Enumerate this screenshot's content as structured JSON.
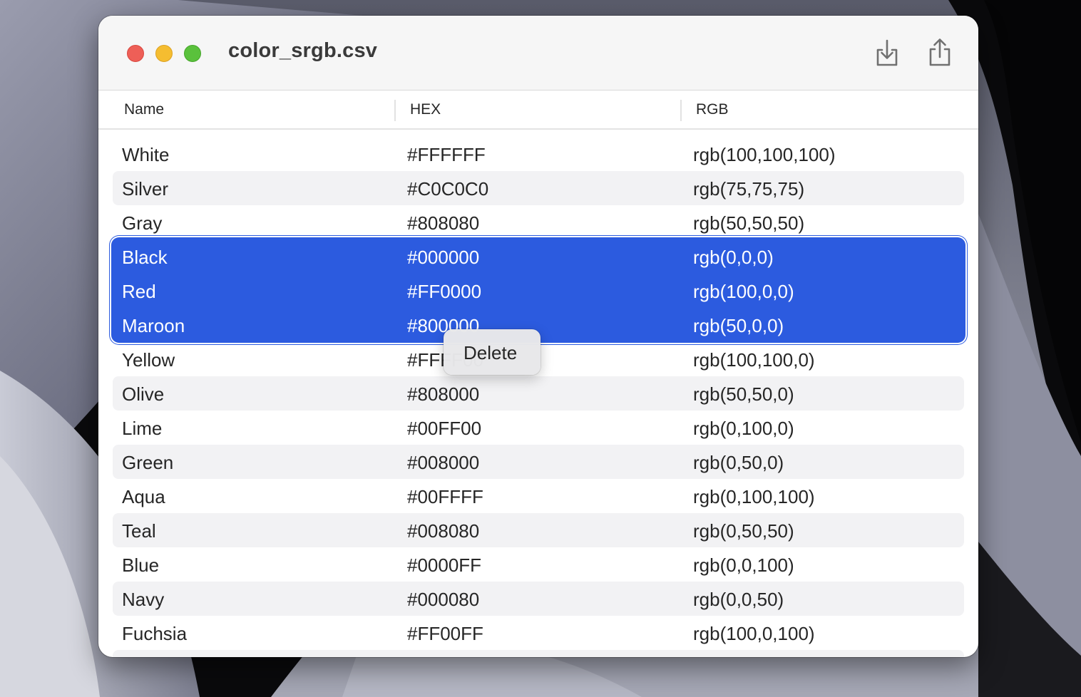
{
  "window": {
    "title": "color_srgb.csv"
  },
  "toolbar": {
    "download_icon": "download-tray-icon",
    "share_icon": "share-icon"
  },
  "table": {
    "columns": [
      "Name",
      "HEX",
      "RGB"
    ],
    "rows": [
      {
        "name": "White",
        "hex": "#FFFFFF",
        "rgb": "rgb(100,100,100)"
      },
      {
        "name": "Silver",
        "hex": "#C0C0C0",
        "rgb": "rgb(75,75,75)"
      },
      {
        "name": "Gray",
        "hex": "#808080",
        "rgb": "rgb(50,50,50)"
      },
      {
        "name": "Black",
        "hex": "#000000",
        "rgb": "rgb(0,0,0)"
      },
      {
        "name": "Red",
        "hex": "#FF0000",
        "rgb": "rgb(100,0,0)"
      },
      {
        "name": "Maroon",
        "hex": "#800000",
        "rgb": "rgb(50,0,0)"
      },
      {
        "name": "Yellow",
        "hex": "#FFFF00",
        "rgb": "rgb(100,100,0)"
      },
      {
        "name": "Olive",
        "hex": "#808000",
        "rgb": "rgb(50,50,0)"
      },
      {
        "name": "Lime",
        "hex": "#00FF00",
        "rgb": "rgb(0,100,0)"
      },
      {
        "name": "Green",
        "hex": "#008000",
        "rgb": "rgb(0,50,0)"
      },
      {
        "name": "Aqua",
        "hex": "#00FFFF",
        "rgb": "rgb(0,100,100)"
      },
      {
        "name": "Teal",
        "hex": "#008080",
        "rgb": "rgb(0,50,50)"
      },
      {
        "name": "Blue",
        "hex": "#0000FF",
        "rgb": "rgb(0,0,100)"
      },
      {
        "name": "Navy",
        "hex": "#000080",
        "rgb": "rgb(0,0,50)"
      },
      {
        "name": "Fuchsia",
        "hex": "#FF00FF",
        "rgb": "rgb(100,0,100)"
      }
    ],
    "selected_rows": [
      "Black",
      "Red",
      "Maroon"
    ]
  },
  "context_menu": {
    "items": [
      "Delete"
    ]
  },
  "colors": {
    "selection": "#2C5BDF",
    "close": "#EE5F57",
    "minimize": "#F5BD30",
    "zoom": "#5AC13C"
  }
}
